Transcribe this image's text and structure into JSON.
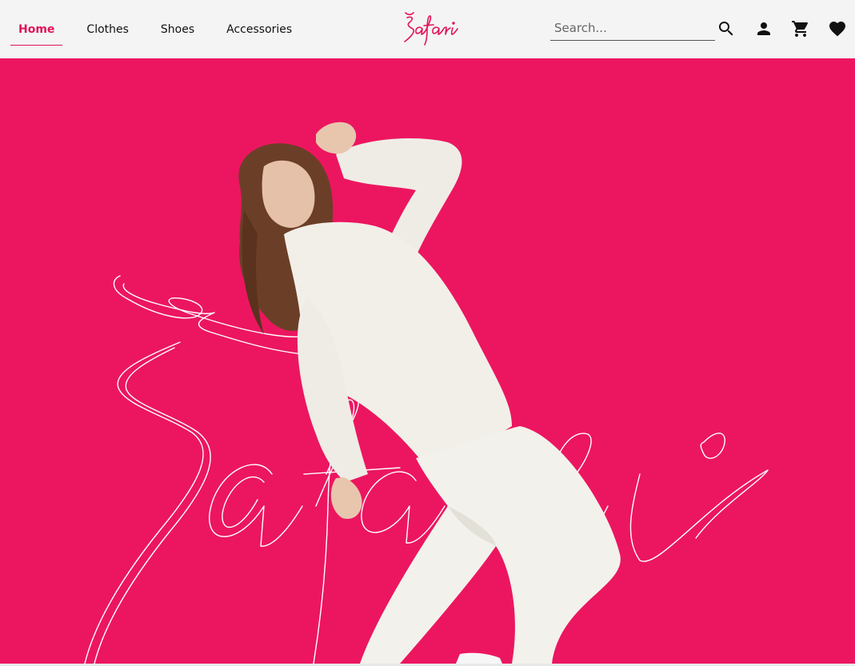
{
  "nav": {
    "links": [
      {
        "label": "Home",
        "active": true
      },
      {
        "label": "Clothes",
        "active": false
      },
      {
        "label": "Shoes",
        "active": false
      },
      {
        "label": "Accessories",
        "active": false
      }
    ]
  },
  "brand": {
    "name": "Safari"
  },
  "search": {
    "placeholder": "Search...",
    "value": ""
  },
  "icons": {
    "search": "search-icon",
    "account": "person-icon",
    "cart": "shopping-cart-icon",
    "wishlist": "heart-icon"
  },
  "colors": {
    "accent": "#e0145a",
    "hero_background": "#ec1660",
    "nav_background": "#f4f4f4",
    "text": "#111111"
  }
}
